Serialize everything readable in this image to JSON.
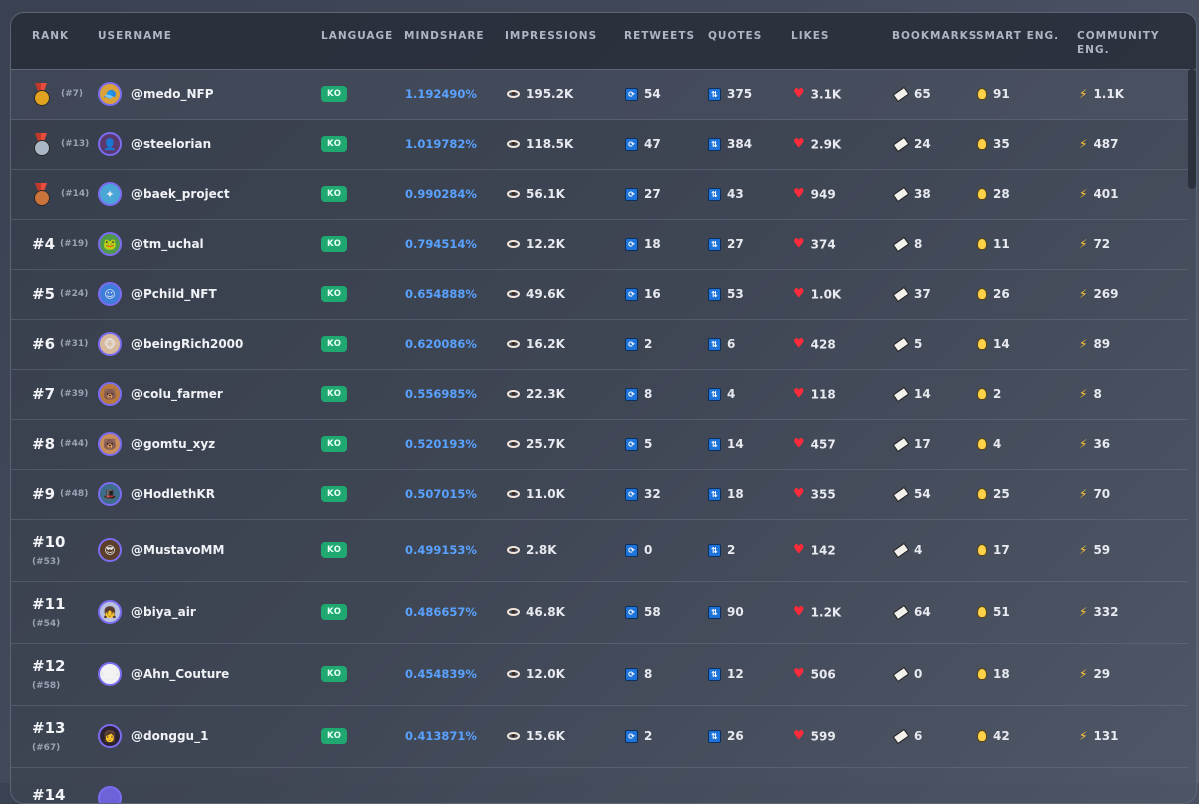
{
  "headers": {
    "rank": "RANK",
    "username": "USERNAME",
    "language": "LANGUAGE",
    "mindshare": "MINDSHARE",
    "impressions": "IMPRESSIONS",
    "retweets": "RETWEETS",
    "quotes": "QUOTES",
    "likes": "LIKES",
    "bookmarks": "BOOKMARKS",
    "smart_eng": "SMART ENG.",
    "community_eng_1": "COMMUNITY",
    "community_eng_2": "ENG."
  },
  "colors": {
    "accent": "#5aa2ff",
    "language_badge": "#1fa971",
    "like_heart": "#ff2b3a",
    "medal_gold": "#e0a21f",
    "medal_silver": "#a9b8c4",
    "medal_bronze": "#c9743a"
  },
  "rows": [
    {
      "rank": "",
      "medal": "gold-medal-icon",
      "sub": "(#7)",
      "username": "@medo_NFP",
      "lang": "KO",
      "mindshare": "1.192490%",
      "impressions": "195.2K",
      "retweets": "54",
      "quotes": "375",
      "likes": "3.1K",
      "bookmarks": "65",
      "smart": "91",
      "community": "1.1K",
      "avatar_bg": "#d9a23a",
      "avatar_glyph": "🧢"
    },
    {
      "rank": "",
      "medal": "silver-medal-icon",
      "sub": "(#13)",
      "username": "@steelorian",
      "lang": "KO",
      "mindshare": "1.019782%",
      "impressions": "118.5K",
      "retweets": "47",
      "quotes": "384",
      "likes": "2.9K",
      "bookmarks": "24",
      "smart": "35",
      "community": "487",
      "avatar_bg": "#5a3a6e",
      "avatar_glyph": "👤"
    },
    {
      "rank": "",
      "medal": "bronze-medal-icon",
      "sub": "(#14)",
      "username": "@baek_project",
      "lang": "KO",
      "mindshare": "0.990284%",
      "impressions": "56.1K",
      "retweets": "27",
      "quotes": "43",
      "likes": "949",
      "bookmarks": "38",
      "smart": "28",
      "community": "401",
      "avatar_bg": "#4aa6d6",
      "avatar_glyph": "✦"
    },
    {
      "rank": "#4",
      "medal": "",
      "sub": "(#19)",
      "username": "@tm_uchal",
      "lang": "KO",
      "mindshare": "0.794514%",
      "impressions": "12.2K",
      "retweets": "18",
      "quotes": "27",
      "likes": "374",
      "bookmarks": "8",
      "smart": "11",
      "community": "72",
      "avatar_bg": "#4f9a4a",
      "avatar_glyph": "🐸"
    },
    {
      "rank": "#5",
      "medal": "",
      "sub": "(#24)",
      "username": "@Pchild_NFT",
      "lang": "KO",
      "mindshare": "0.654888%",
      "impressions": "49.6K",
      "retweets": "16",
      "quotes": "53",
      "likes": "1.0K",
      "bookmarks": "37",
      "smart": "26",
      "community": "269",
      "avatar_bg": "#3f7ed8",
      "avatar_glyph": "☺"
    },
    {
      "rank": "#6",
      "medal": "",
      "sub": "(#31)",
      "username": "@beingRich2000",
      "lang": "KO",
      "mindshare": "0.620086%",
      "impressions": "16.2K",
      "retweets": "2",
      "quotes": "6",
      "likes": "428",
      "bookmarks": "5",
      "smart": "14",
      "community": "89",
      "avatar_bg": "#d8b99c",
      "avatar_glyph": "🐵"
    },
    {
      "rank": "#7",
      "medal": "",
      "sub": "(#39)",
      "username": "@colu_farmer",
      "lang": "KO",
      "mindshare": "0.556985%",
      "impressions": "22.3K",
      "retweets": "8",
      "quotes": "4",
      "likes": "118",
      "bookmarks": "14",
      "smart": "2",
      "community": "8",
      "avatar_bg": "#b9793a",
      "avatar_glyph": "🐻"
    },
    {
      "rank": "#8",
      "medal": "",
      "sub": "(#44)",
      "username": "@gomtu_xyz",
      "lang": "KO",
      "mindshare": "0.520193%",
      "impressions": "25.7K",
      "retweets": "5",
      "quotes": "14",
      "likes": "457",
      "bookmarks": "17",
      "smart": "4",
      "community": "36",
      "avatar_bg": "#c98e5a",
      "avatar_glyph": "🐻"
    },
    {
      "rank": "#9",
      "medal": "",
      "sub": "(#48)",
      "username": "@HodlethKR",
      "lang": "KO",
      "mindshare": "0.507015%",
      "impressions": "11.0K",
      "retweets": "32",
      "quotes": "18",
      "likes": "355",
      "bookmarks": "54",
      "smart": "25",
      "community": "70",
      "avatar_bg": "#3e6d8c",
      "avatar_glyph": "🎩"
    },
    {
      "rank": "#10",
      "medal": "",
      "sub": "(#53)",
      "username": "@MustavoMM",
      "lang": "KO",
      "mindshare": "0.499153%",
      "impressions": "2.8K",
      "retweets": "0",
      "quotes": "2",
      "likes": "142",
      "bookmarks": "4",
      "smart": "17",
      "community": "59",
      "avatar_bg": "#5c3f2a",
      "avatar_glyph": "😎"
    },
    {
      "rank": "#11",
      "medal": "",
      "sub": "(#54)",
      "username": "@biya_air",
      "lang": "KO",
      "mindshare": "0.486657%",
      "impressions": "46.8K",
      "retweets": "58",
      "quotes": "90",
      "likes": "1.2K",
      "bookmarks": "64",
      "smart": "51",
      "community": "332",
      "avatar_bg": "#b9c2e0",
      "avatar_glyph": "👧"
    },
    {
      "rank": "#12",
      "medal": "",
      "sub": "(#58)",
      "username": "@Ahn_Couture",
      "lang": "KO",
      "mindshare": "0.454839%",
      "impressions": "12.0K",
      "retweets": "8",
      "quotes": "12",
      "likes": "506",
      "bookmarks": "0",
      "smart": "18",
      "community": "29",
      "avatar_bg": "#f2f2f2",
      "avatar_glyph": "•‿•"
    },
    {
      "rank": "#13",
      "medal": "",
      "sub": "(#67)",
      "username": "@donggu_1",
      "lang": "KO",
      "mindshare": "0.413871%",
      "impressions": "15.6K",
      "retweets": "2",
      "quotes": "26",
      "likes": "599",
      "bookmarks": "6",
      "smart": "42",
      "community": "131",
      "avatar_bg": "#2a2230",
      "avatar_glyph": "👩"
    },
    {
      "rank": "#14",
      "medal": "",
      "sub": "",
      "username": "",
      "lang": "",
      "mindshare": "",
      "impressions": "",
      "retweets": "",
      "quotes": "",
      "likes": "",
      "bookmarks": "",
      "smart": "",
      "community": "",
      "avatar_bg": "#6d62d8",
      "avatar_glyph": ""
    }
  ]
}
